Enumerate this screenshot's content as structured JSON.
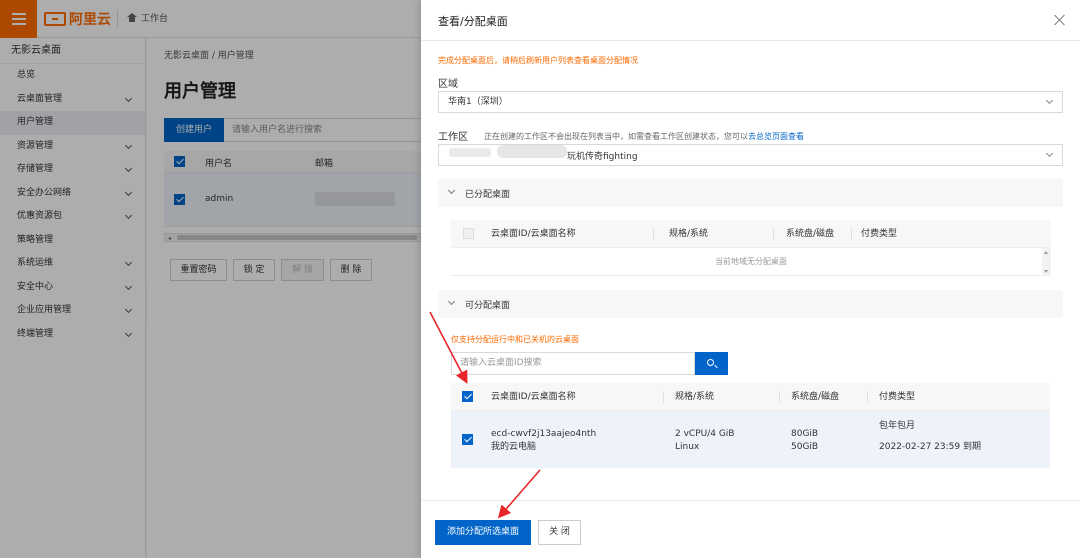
{
  "topbar": {
    "logo_text": "阿里云",
    "workbench_label": "工作台"
  },
  "sidebar": {
    "title": "无影云桌面",
    "items": [
      {
        "label": "总览",
        "expandable": false
      },
      {
        "label": "云桌面管理",
        "expandable": true
      },
      {
        "label": "用户管理",
        "expandable": false,
        "active": true
      },
      {
        "label": "资源管理",
        "expandable": true
      },
      {
        "label": "存储管理",
        "expandable": true
      },
      {
        "label": "安全办公网络",
        "expandable": true
      },
      {
        "label": "优惠资源包",
        "expandable": true
      },
      {
        "label": "策略管理",
        "expandable": false
      },
      {
        "label": "系统运维",
        "expandable": true
      },
      {
        "label": "安全中心",
        "expandable": true
      },
      {
        "label": "企业应用管理",
        "expandable": true
      },
      {
        "label": "终端管理",
        "expandable": true
      }
    ]
  },
  "main": {
    "breadcrumb": "无影云桌面 / 用户管理",
    "title": "用户管理",
    "create_button": "创建用户",
    "search_placeholder": "请输入用户名进行搜索",
    "table": {
      "col_username": "用户名",
      "col_email": "邮箱",
      "row_username": "admin"
    },
    "buttons": {
      "reset_password": "重置密码",
      "lock": "锁 定",
      "unlock": "解 锁",
      "delete": "删 除"
    }
  },
  "drawer": {
    "title": "查看/分配桌面",
    "notice": "完成分配桌面后，请稍后刷新用户列表查看桌面分配情况",
    "region_label": "区域",
    "region_value": "华南1（深圳）",
    "workspace_label": "工作区",
    "workspace_hint": "正在创建的工作区不会出现在列表当中，如需查看工作区创建状态，您可以",
    "workspace_hint_link": "去总览页面查看",
    "workspace_value": "玩机传奇fighting",
    "assigned_section": "已分配桌面",
    "available_section": "可分配桌面",
    "table_headers": {
      "id_name": "云桌面ID/云桌面名称",
      "spec": "规格/系统",
      "disk": "系统盘/磁盘",
      "billing": "付费类型"
    },
    "empty_text": "当前地域无分配桌面",
    "available_warning": "仅支持分配运行中和已关机的云桌面",
    "desk_search_placeholder": "请输入云桌面ID搜索",
    "desktop": {
      "id": "ecd-cwvf2j13aajeo4nth",
      "name": "我的云电脑",
      "spec": "2 vCPU/4 GiB",
      "os": "Linux",
      "system_disk": "80GiB",
      "data_disk": "50GiB",
      "billing_type": "包年包月",
      "expire": "2022-02-27 23:59 到期"
    },
    "add_button": "添加分配所选桌面",
    "close_button": "关 闭"
  },
  "colors": {
    "brand_orange": "#ff6a00",
    "primary_blue": "#0064c8",
    "annotation_red": "#e8262a"
  }
}
